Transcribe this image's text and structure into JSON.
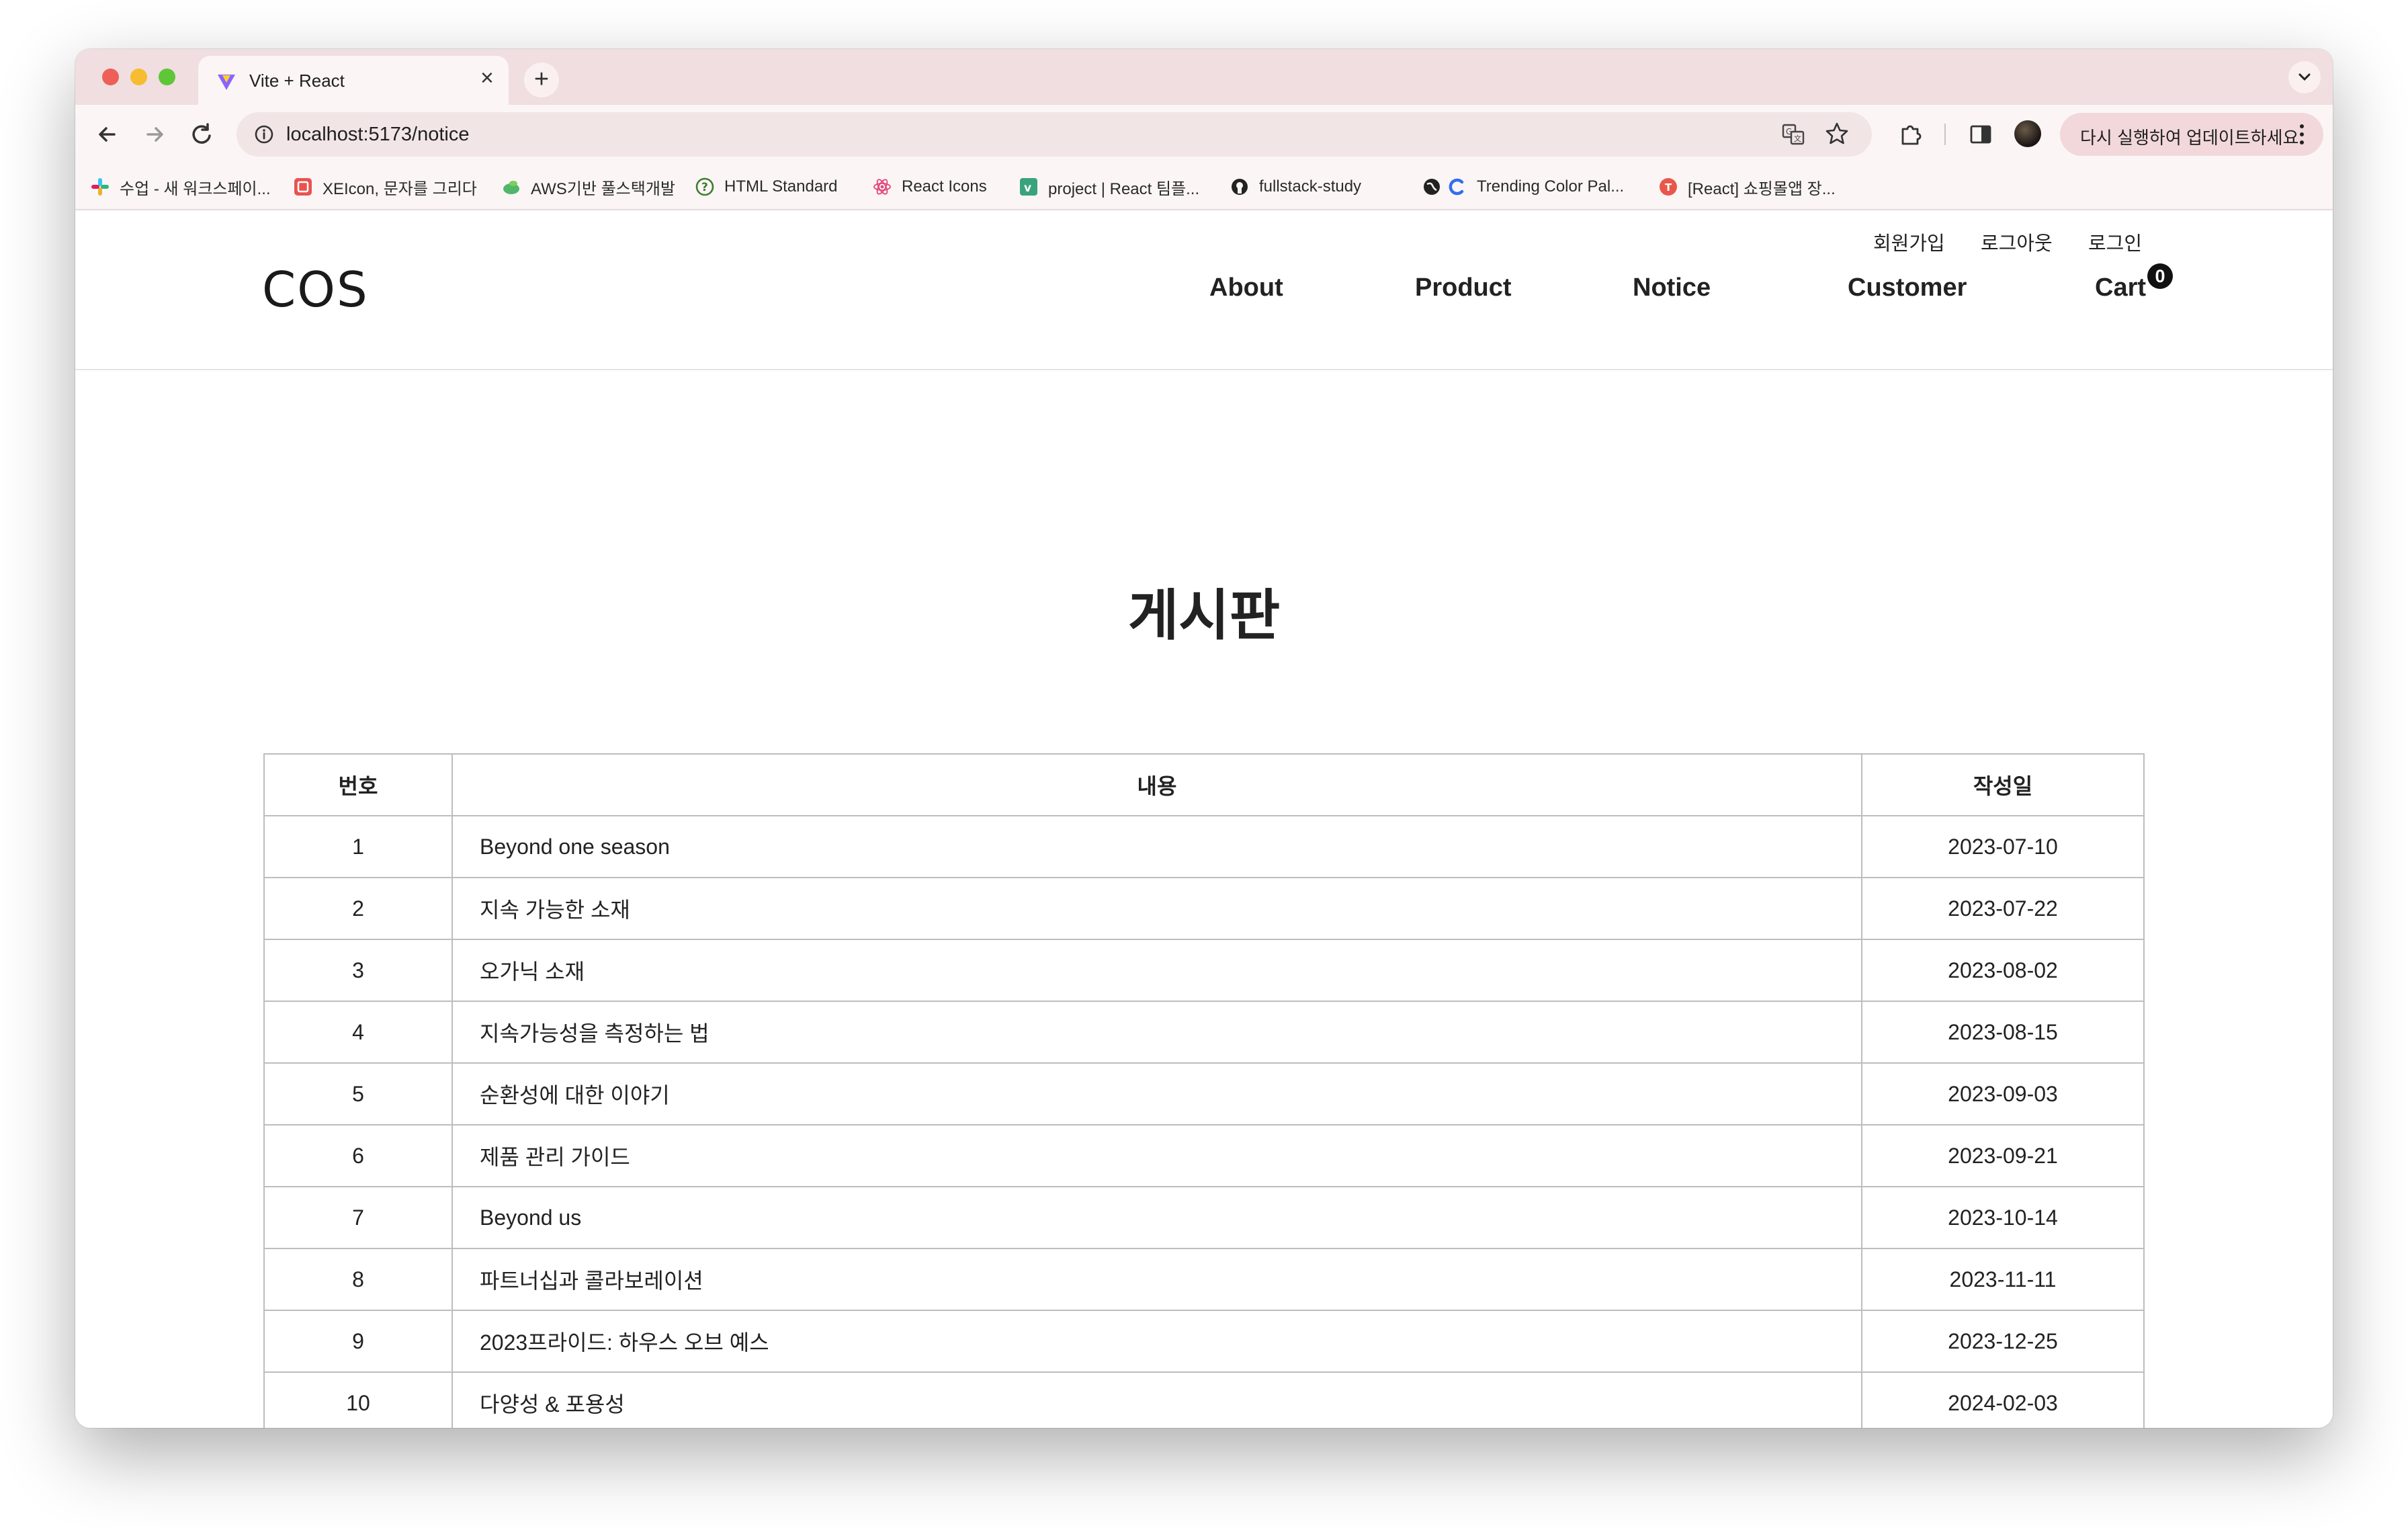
{
  "browser": {
    "tab_title": "Vite + React",
    "tab_close": "×",
    "new_tab": "+",
    "url": "localhost:5173/notice",
    "update_label": "다시 실행하여 업데이트하세요.",
    "bookmarks": [
      {
        "label": "수업 - 새 워크스페이...",
        "icon": "slack-icon",
        "color": "#e01e5a"
      },
      {
        "label": "XEIcon, 문자를 그리다",
        "icon": "xeicon-icon",
        "color": "#e8534f"
      },
      {
        "label": "AWS기반 풀스택개발",
        "icon": "cloud-leaf-icon",
        "color": "#3aa55c"
      },
      {
        "label": "HTML Standard",
        "icon": "html-standard-icon",
        "color": "#3c7d2e"
      },
      {
        "label": "React Icons",
        "icon": "react-icon",
        "color": "#e0457b"
      },
      {
        "label": "project | React 팀플...",
        "icon": "vercel-v-icon",
        "color": "#39a37c"
      },
      {
        "label": "fullstack-study",
        "icon": "github-icon",
        "color": "#222222"
      },
      {
        "label": "",
        "icon": "globe-icon",
        "color": "#222222"
      },
      {
        "label": "Trending Color Pal...",
        "icon": "coolors-icon",
        "color": "#2f6ff0"
      },
      {
        "label": "[React] 쇼핑몰앱 장...",
        "icon": "velog-icon",
        "color": "#e8584a"
      }
    ]
  },
  "site": {
    "logo": "COS",
    "util_links": [
      "회원가입",
      "로그아웃",
      "로그인"
    ],
    "nav": [
      "About",
      "Product",
      "Notice",
      "Customer",
      "Cart"
    ],
    "cart_count": "0"
  },
  "board": {
    "title": "게시판",
    "headers": [
      "번호",
      "내용",
      "작성일"
    ],
    "rows": [
      {
        "num": "1",
        "content": "Beyond one season",
        "date": "2023-07-10"
      },
      {
        "num": "2",
        "content": "지속 가능한 소재",
        "date": "2023-07-22"
      },
      {
        "num": "3",
        "content": "오가닉 소재",
        "date": "2023-08-02"
      },
      {
        "num": "4",
        "content": "지속가능성을 측정하는 법",
        "date": "2023-08-15"
      },
      {
        "num": "5",
        "content": "순환성에 대한 이야기",
        "date": "2023-09-03"
      },
      {
        "num": "6",
        "content": "제품 관리 가이드",
        "date": "2023-09-21"
      },
      {
        "num": "7",
        "content": "Beyond us",
        "date": "2023-10-14"
      },
      {
        "num": "8",
        "content": "파트너십과 콜라보레이션",
        "date": "2023-11-11"
      },
      {
        "num": "9",
        "content": "2023프라이드: 하우스 오브 예스",
        "date": "2023-12-25"
      },
      {
        "num": "10",
        "content": "다양성 & 포용성",
        "date": "2024-02-03"
      }
    ],
    "pagination_colors": {
      "active": "#f07c5c",
      "inactive": "#dddddd"
    }
  }
}
